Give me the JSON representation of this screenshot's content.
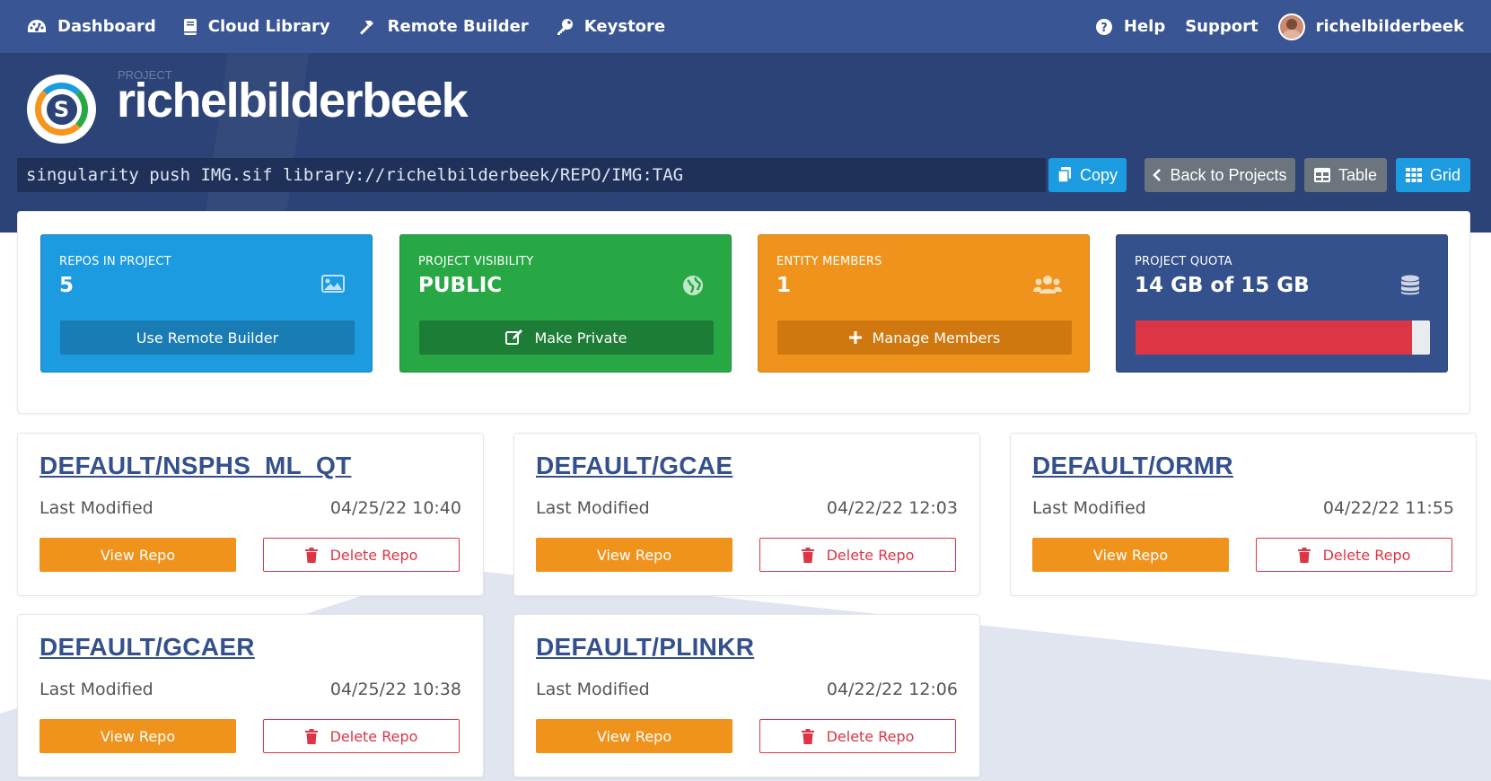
{
  "nav": {
    "left": [
      {
        "label": "Dashboard",
        "icon": "dashboard-icon"
      },
      {
        "label": "Cloud Library",
        "icon": "book-icon"
      },
      {
        "label": "Remote Builder",
        "icon": "hammer-icon"
      },
      {
        "label": "Keystore",
        "icon": "key-icon"
      }
    ],
    "right": {
      "help": "Help",
      "support": "Support",
      "username": "richelbilderbeek"
    }
  },
  "header": {
    "project_label": "PROJECT",
    "project_name": "richelbilderbeek",
    "push_command": "singularity push IMG.sif library://richelbilderbeek/REPO/IMG:TAG",
    "copy_label": "Copy",
    "back_label": "Back to Projects",
    "table_label": "Table",
    "grid_label": "Grid"
  },
  "stats": {
    "repos": {
      "label": "REPOS IN PROJECT",
      "value": "5",
      "button": "Use Remote Builder",
      "icon": "image-icon"
    },
    "visibility": {
      "label": "PROJECT VISIBILITY",
      "value": "PUBLIC",
      "button": "Make Private",
      "icon": "globe-icon"
    },
    "members": {
      "label": "ENTITY MEMBERS",
      "value": "1",
      "button": "Manage Members",
      "icon": "users-icon"
    },
    "quota": {
      "label": "PROJECT QUOTA",
      "value": "14 GB of 15 GB",
      "fill_percent": 94,
      "icon": "database-icon"
    }
  },
  "repos": [
    {
      "name": "DEFAULT/NSPHS_ML_QT",
      "modified_label": "Last Modified",
      "modified": "04/25/22 10:40",
      "view": "View Repo",
      "delete": "Delete Repo"
    },
    {
      "name": "DEFAULT/GCAE",
      "modified_label": "Last Modified",
      "modified": "04/22/22 12:03",
      "view": "View Repo",
      "delete": "Delete Repo"
    },
    {
      "name": "DEFAULT/ORMR",
      "modified_label": "Last Modified",
      "modified": "04/22/22 11:55",
      "view": "View Repo",
      "delete": "Delete Repo"
    },
    {
      "name": "DEFAULT/GCAER",
      "modified_label": "Last Modified",
      "modified": "04/25/22 10:38",
      "view": "View Repo",
      "delete": "Delete Repo"
    },
    {
      "name": "DEFAULT/PLINKR",
      "modified_label": "Last Modified",
      "modified": "04/22/22 12:06",
      "view": "View Repo",
      "delete": "Delete Repo"
    }
  ],
  "colors": {
    "navbar": "#3a5593",
    "header": "#2b4376",
    "blue": "#1d9be0",
    "green": "#28a745",
    "orange": "#f0931d",
    "danger": "#dc3545"
  }
}
